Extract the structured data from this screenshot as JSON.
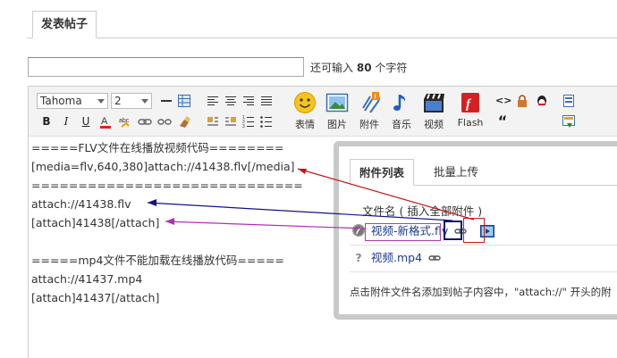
{
  "tab": {
    "label": "发表帖子"
  },
  "subject": {
    "value": "",
    "remain_prefix": "还可输入",
    "remain_count": "80",
    "remain_suffix": "个字符"
  },
  "toolbar": {
    "font": "Tahoma",
    "size": "2",
    "buttons": [
      {
        "icon": "smile-icon",
        "label": "表情"
      },
      {
        "icon": "image-icon",
        "label": "图片"
      },
      {
        "icon": "attach-icon",
        "label": "附件"
      },
      {
        "icon": "music-icon",
        "label": "音乐"
      },
      {
        "icon": "video-icon",
        "label": "视频"
      },
      {
        "icon": "flash-icon",
        "label": "Flash"
      }
    ],
    "quote_glyph": "“",
    "code_glyph": "<>"
  },
  "editor": {
    "lines": [
      "=====FLV文件在线播放视频代码========",
      "[media=flv,640,380]attach://41438.flv[/media]",
      "=============================",
      "attach://41438.flv",
      "[attach]41438[/attach]",
      "",
      "=====mp4文件不能加载在线播放代码=====",
      "attach://41437.mp4",
      "[attach]41437[/attach]"
    ]
  },
  "attachments": {
    "tabs": [
      "附件列表",
      "批量上传"
    ],
    "header": "文件名 ( 插入全部附件 )",
    "items": [
      {
        "name": "视频-新格式.flv"
      },
      {
        "name": "视频.mp4"
      }
    ],
    "note": "点击附件文件名添加到帖子内容中，\"attach://\" 开头的附"
  },
  "colors": {
    "arrow_red": "#c81414",
    "arrow_blue": "#141480",
    "arrow_purple": "#b030b0",
    "link": "#1a3d8c"
  }
}
